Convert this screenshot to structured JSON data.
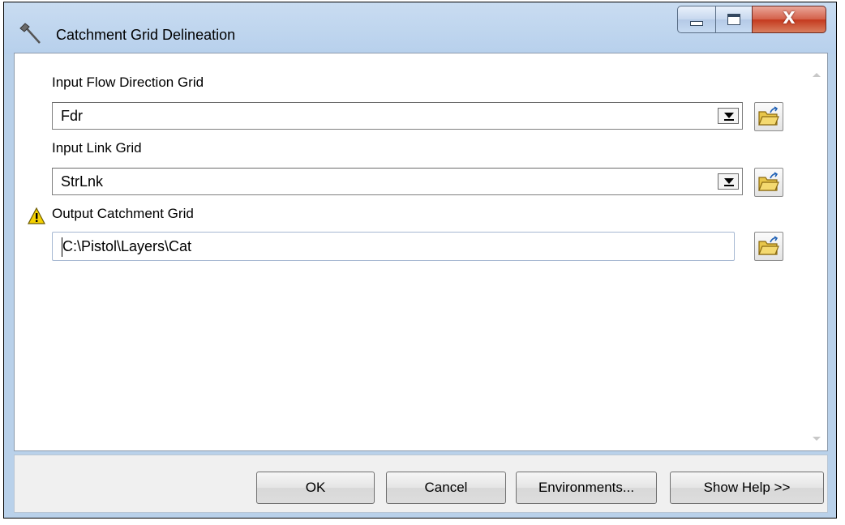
{
  "window": {
    "title": "Catchment Grid Delineation",
    "close_glyph": "X"
  },
  "form": {
    "flow_direction": {
      "label": "Input Flow Direction Grid",
      "value": "Fdr"
    },
    "link_grid": {
      "label": "Input Link Grid",
      "value": "StrLnk"
    },
    "catchment_output": {
      "label": "Output Catchment Grid",
      "value": "C:\\Pistol\\Layers\\Cat"
    }
  },
  "buttons": {
    "ok": "OK",
    "cancel": "Cancel",
    "environments": "Environments...",
    "show_help": "Show Help >>"
  },
  "icons": {
    "title": "hammer-icon",
    "browse": "open-folder-icon",
    "warning": "warning-triangle-icon"
  },
  "colors": {
    "frame": "#b9d1ea",
    "close_button": "#c4391e",
    "warning": "#f5d100",
    "folder": "#e8c64a"
  }
}
